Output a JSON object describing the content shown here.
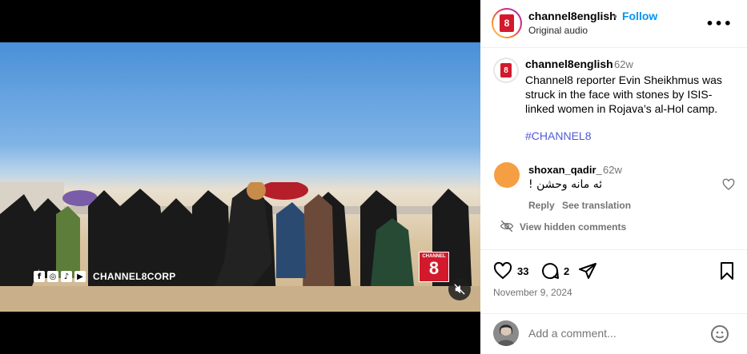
{
  "video": {
    "social_handle": "CHANNEL8CORP",
    "social_icons": [
      "facebook-icon",
      "instagram-icon",
      "tiktok-icon",
      "youtube-icon"
    ],
    "logo_top": "CHANNEL",
    "logo_num": "8"
  },
  "header": {
    "username": "channel8english",
    "separator": "•",
    "follow_label": "Follow",
    "audio": "Original audio",
    "more_label": "•••"
  },
  "caption": {
    "username": "channel8english",
    "time": "62w",
    "text": "Channel8 reporter Evin Sheikhmus was struck in the face with stones by ISIS-linked women in Rojava’s al-Hol camp.",
    "hashtag": "#CHANNEL8"
  },
  "comment": {
    "username": "shoxan_qadir_",
    "time": "62w",
    "text": "ئه مانه وحشن !",
    "reply_label": "Reply",
    "translation_label": "See translation"
  },
  "hidden_comments_label": "View hidden comments",
  "actions": {
    "likes": "33",
    "comments": "2",
    "date": "November 9, 2024"
  },
  "add_comment": {
    "placeholder": "Add a comment..."
  },
  "colors": {
    "brand_red": "#d31a2c",
    "follow_blue": "#0095f6",
    "hashtag": "#4f5bd5",
    "muted": "#737373"
  }
}
